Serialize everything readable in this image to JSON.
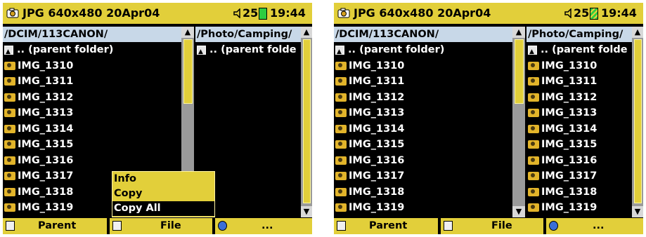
{
  "screens": [
    {
      "header": {
        "title": "JPG 640x480 20Apr04",
        "volume": "25",
        "time": "19:44"
      },
      "left_pane": {
        "path": "/DCIM/113CANON/",
        "items": [
          "IMG_1310",
          "IMG_1311",
          "IMG_1312",
          "IMG_1313",
          "IMG_1314",
          "IMG_1315",
          "IMG_1316",
          "IMG_1317",
          "IMG_1318",
          "IMG_1319"
        ],
        "parent_label": ".. (parent folder)"
      },
      "right_pane": {
        "path": "/Photo/Camping/",
        "parent_label": ".. (parent folde"
      },
      "context_menu": {
        "items": [
          "Info",
          "Copy",
          "Copy All"
        ],
        "selected": "Copy All"
      },
      "footer": {
        "parent_label": "Parent",
        "file_label": "File",
        "more_label": "..."
      }
    },
    {
      "header": {
        "title": "JPG 640x480 20Apr04",
        "volume": "25",
        "time": "19:44"
      },
      "left_pane": {
        "path": "/DCIM/113CANON/",
        "items": [
          "IMG_1310",
          "IMG_1311",
          "IMG_1312",
          "IMG_1313",
          "IMG_1314",
          "IMG_1315",
          "IMG_1316",
          "IMG_1317",
          "IMG_1318",
          "IMG_1319"
        ],
        "parent_label": ".. (parent folder)"
      },
      "right_pane": {
        "path": "/Photo/Camping/",
        "parent_label": ".. (parent folde",
        "items": [
          "IMG_1310",
          "IMG_1311",
          "IMG_1312",
          "IMG_1313",
          "IMG_1314",
          "IMG_1315",
          "IMG_1316",
          "IMG_1317",
          "IMG_1318",
          "IMG_1319"
        ]
      },
      "footer": {
        "parent_label": "Parent",
        "file_label": "File",
        "more_label": "..."
      }
    }
  ],
  "colors": {
    "accent": "#e2cf3a",
    "path_bar": "#c8d8e8",
    "background": "#000000"
  },
  "icons": {
    "header": "camera-icon",
    "volume": "speaker-icon",
    "battery": "battery-icon",
    "file": "photo-file-icon",
    "parent": "parent-folder-icon"
  }
}
